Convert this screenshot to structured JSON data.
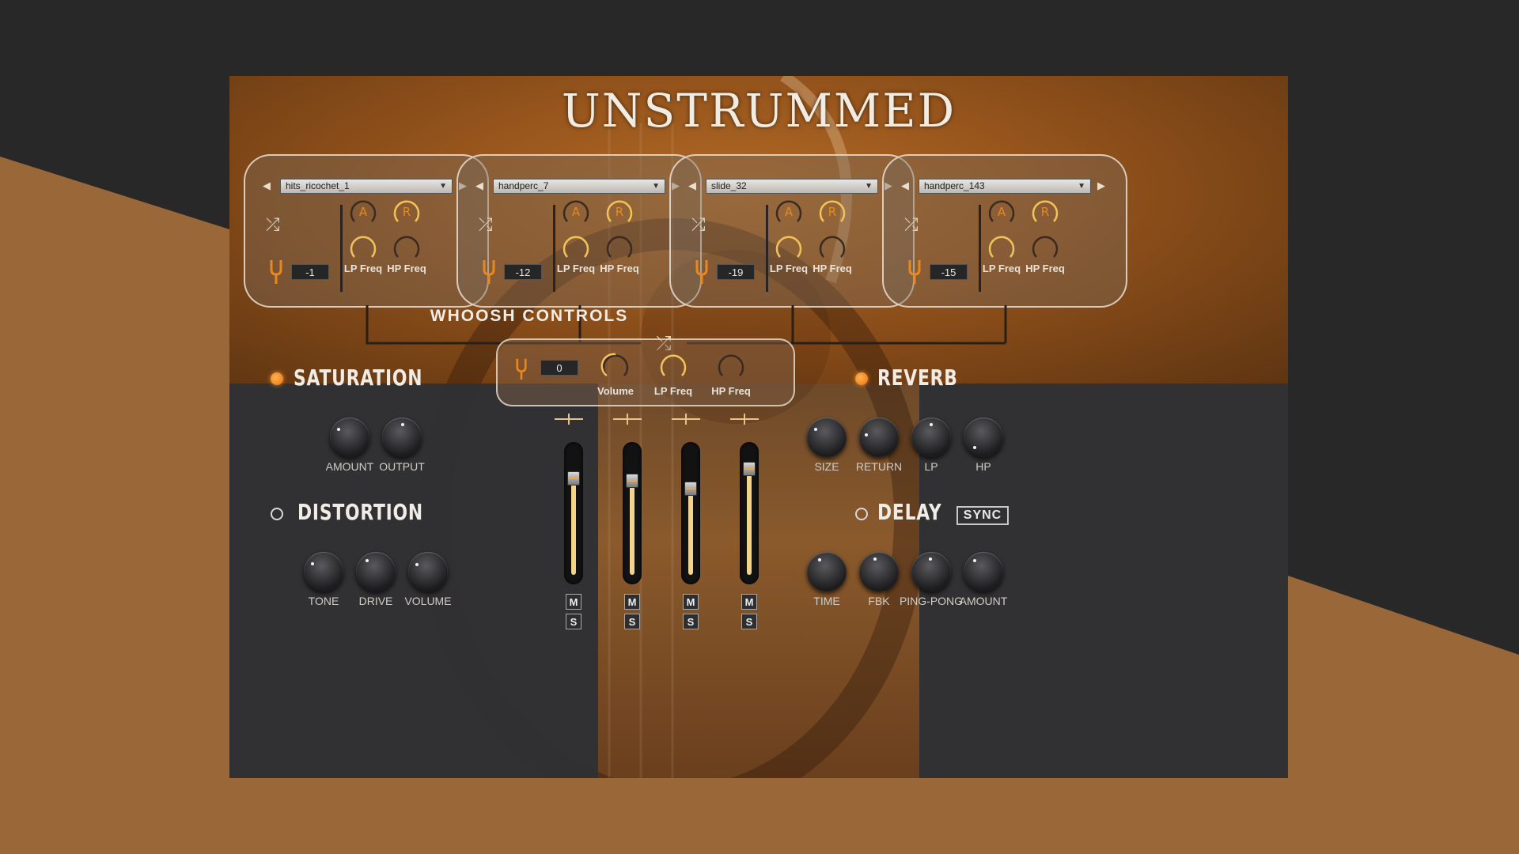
{
  "colors": {
    "accent_orange": "#f08a2a",
    "knob_arc": "#f2c35a",
    "background_dark": "#282828",
    "background_tan": "#9a6838"
  },
  "title": "UNSTRUMMED",
  "slots": [
    {
      "sample": "hits_ricochet_1",
      "tune": "-1",
      "attack": "A",
      "release": "R",
      "lp_label": "LP Freq",
      "hp_label": "HP Freq"
    },
    {
      "sample": "handperc_7",
      "tune": "-12",
      "attack": "A",
      "release": "R",
      "lp_label": "LP Freq",
      "hp_label": "HP Freq"
    },
    {
      "sample": "slide_32",
      "tune": "-19",
      "attack": "A",
      "release": "R",
      "lp_label": "LP Freq",
      "hp_label": "HP Freq"
    },
    {
      "sample": "handperc_143",
      "tune": "-15",
      "attack": "A",
      "release": "R",
      "lp_label": "LP Freq",
      "hp_label": "HP Freq"
    }
  ],
  "whoosh": {
    "title": "WHOOSH CONTROLS",
    "tune": "0",
    "volume_label": "Volume",
    "lp_label": "LP Freq",
    "hp_label": "HP Freq"
  },
  "saturation": {
    "title": "SATURATION",
    "enabled": true,
    "knobs": [
      "AMOUNT",
      "OUTPUT"
    ]
  },
  "distortion": {
    "title": "DISTORTION",
    "enabled": false,
    "knobs": [
      "TONE",
      "DRIVE",
      "VOLUME"
    ]
  },
  "reverb": {
    "title": "REVERB",
    "enabled": true,
    "knobs": [
      "SIZE",
      "RETURN",
      "LP",
      "HP"
    ]
  },
  "delay": {
    "title": "DELAY",
    "enabled": false,
    "sync_label": "SYNC",
    "knobs": [
      "TIME",
      "FBK",
      "PING-PONG",
      "AMOUNT"
    ]
  },
  "mixer": {
    "mute_label": "M",
    "solo_label": "S",
    "levels": [
      0.78,
      0.76,
      0.7,
      0.86
    ]
  }
}
